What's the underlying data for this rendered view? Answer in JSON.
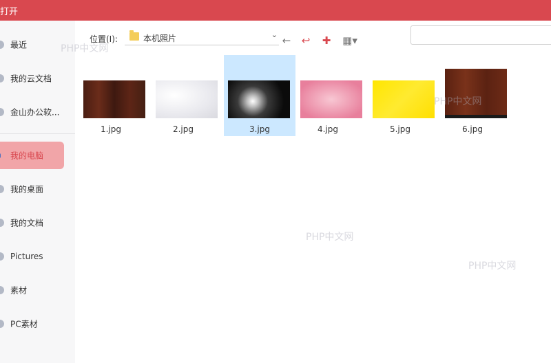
{
  "window": {
    "title": "打开"
  },
  "sidebar": {
    "items": [
      {
        "label": "最近"
      },
      {
        "label": "我的云文档"
      },
      {
        "label": "金山办公软..."
      },
      {
        "label": "我的电脑"
      },
      {
        "label": "我的桌面"
      },
      {
        "label": "我的文档"
      },
      {
        "label": "Pictures"
      },
      {
        "label": "素材"
      },
      {
        "label": "PC素材"
      }
    ],
    "active_index": 3
  },
  "toolbar": {
    "location_label": "位置(I):",
    "path": "本机照片",
    "icons": [
      "back-icon",
      "up-folder-icon",
      "new-folder-icon",
      "view-grid-icon"
    ]
  },
  "files": [
    {
      "name": "1.jpg"
    },
    {
      "name": "2.jpg"
    },
    {
      "name": "3.jpg",
      "selected": true
    },
    {
      "name": "4.jpg"
    },
    {
      "name": "5.jpg"
    },
    {
      "name": "6.jpg"
    }
  ],
  "watermarks": {
    "w1": "PHP中文网",
    "w2": "PHP中文网",
    "w3": "PHP中文网",
    "w4": "PHP中文网"
  },
  "colors": {
    "titlebar": "#d9484f",
    "selection": "#cce8ff",
    "active_nav": "#f1a5a8"
  }
}
